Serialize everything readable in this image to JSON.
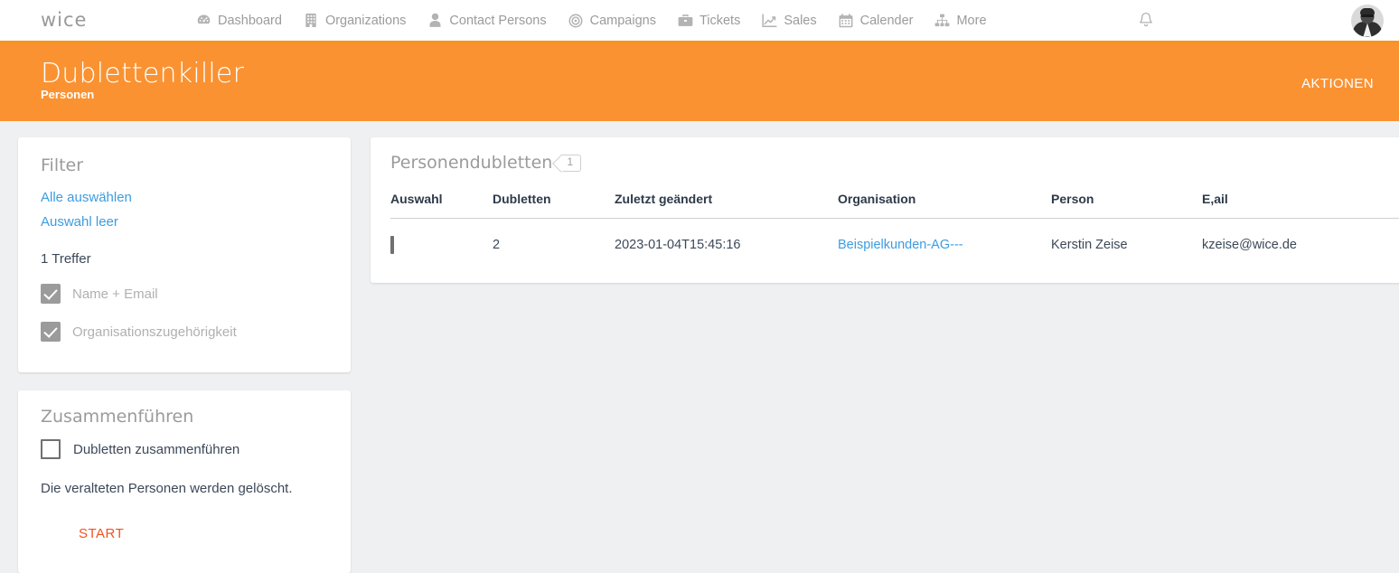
{
  "navbar": {
    "brand": "wice",
    "items": [
      {
        "label": "Dashboard",
        "icon": "gauge-icon"
      },
      {
        "label": "Organizations",
        "icon": "building-icon"
      },
      {
        "label": "Contact Persons",
        "icon": "person-icon"
      },
      {
        "label": "Campaigns",
        "icon": "target-icon"
      },
      {
        "label": "Tickets",
        "icon": "briefcase-icon"
      },
      {
        "label": "Sales",
        "icon": "line-chart-icon"
      },
      {
        "label": "Calender",
        "icon": "calendar-icon"
      },
      {
        "label": "More",
        "icon": "sitemap-icon"
      }
    ],
    "notifications_icon": "bell-icon",
    "avatar_icon": "user-avatar"
  },
  "page_header": {
    "title": "Dublettenkiller",
    "subtitle": "Personen",
    "action_label": "AKTIONEN",
    "background_color": "#fa9232"
  },
  "filter_card": {
    "title": "Filter",
    "select_all_label": "Alle auswählen",
    "clear_selection_label": "Auswahl leer",
    "result_count_label": "1 Treffer",
    "checkboxes": [
      {
        "label": "Name + Email",
        "checked": true,
        "disabled": true
      },
      {
        "label": "Organisationszugehörigkeit",
        "checked": true,
        "disabled": true
      }
    ]
  },
  "merge_card": {
    "title": "Zusammenführen",
    "checkbox_label": "Dubletten zusammenführen",
    "checkbox_checked": false,
    "note": "Die veralteten Personen werden gelöscht.",
    "start_label": "START",
    "start_color": "#f4511e"
  },
  "table_card": {
    "title": "Personendubletten",
    "badge_count": "1",
    "columns": [
      "Auswahl",
      "Dubletten",
      "Zuletzt geändert",
      "Organisation",
      "Person",
      "E,ail"
    ],
    "rows": [
      {
        "selected": false,
        "dubletten": "2",
        "zuletzt_geaendert": "2023-01-04T15:45:16",
        "organisation": "Beispielkunden-AG---",
        "person": "Kerstin Zeise",
        "email": "kzeise@wice.de"
      }
    ]
  },
  "colors": {
    "accent_orange": "#fa9232",
    "link_blue": "#3d9ce0",
    "start_orange": "#f4511e",
    "page_background": "#eff0f2"
  }
}
